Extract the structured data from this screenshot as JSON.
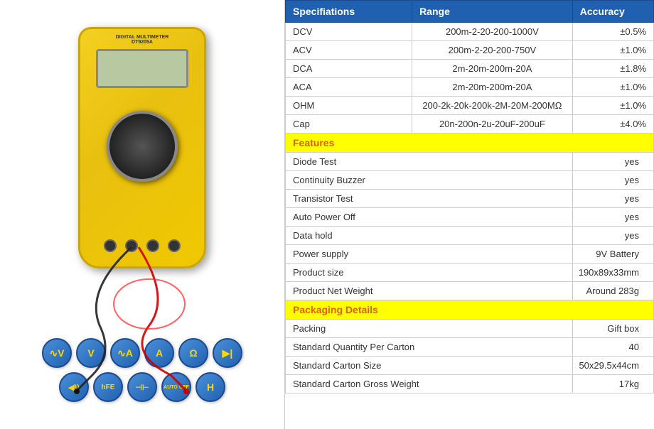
{
  "header": {
    "col1": "Specifiations",
    "col2": "Range",
    "col3": "Accuracy"
  },
  "specs": [
    {
      "name": "DCV",
      "range": "200m-2-20-200-1000V",
      "accuracy": "±0.5%"
    },
    {
      "name": "ACV",
      "range": "200m-2-20-200-750V",
      "accuracy": "±1.0%"
    },
    {
      "name": "DCA",
      "range": "2m-20m-200m-20A",
      "accuracy": "±1.8%"
    },
    {
      "name": "ACA",
      "range": "2m-20m-200m-20A",
      "accuracy": "±1.0%"
    },
    {
      "name": "OHM",
      "range": "200-2k-20k-200k-2M-20M-200MΩ",
      "accuracy": "±1.0%"
    },
    {
      "name": "Cap",
      "range": "20n-200n-2u-20uF-200uF",
      "accuracy": "±4.0%"
    }
  ],
  "features_header": "Features",
  "features": [
    {
      "label": "Diode Test",
      "value": "yes"
    },
    {
      "label": "Continuity Buzzer",
      "value": "yes"
    },
    {
      "label": "Transistor Test",
      "value": "yes"
    },
    {
      "label": "Auto Power Off",
      "value": "yes"
    },
    {
      "label": "Data hold",
      "value": "yes"
    },
    {
      "label": "Power supply",
      "value": "9V Battery"
    },
    {
      "label": "Product size",
      "value": "190x89x33mm"
    },
    {
      "label": "Product Net Weight",
      "value": "Around 283g"
    }
  ],
  "packaging_header": "Packaging Details",
  "packaging": [
    {
      "label": "Packing",
      "value": "Gift box"
    },
    {
      "label": "Standard Quantity Per Carton",
      "value": "40"
    },
    {
      "label": "Standard Carton Size",
      "value": "50x29.5x44cm"
    },
    {
      "label": "Standard Carton Gross Weight",
      "value": "17kg"
    }
  ],
  "symbols": [
    "∿V",
    "V",
    "∿A",
    "A",
    "Ω",
    "▶|"
  ],
  "symbols2": [
    "◀))",
    "hFE",
    "⊣⊢",
    "AUTO OFF",
    "H"
  ],
  "meter_brand": "DIGITAL MULTIMETER",
  "meter_model": "DT9205A"
}
